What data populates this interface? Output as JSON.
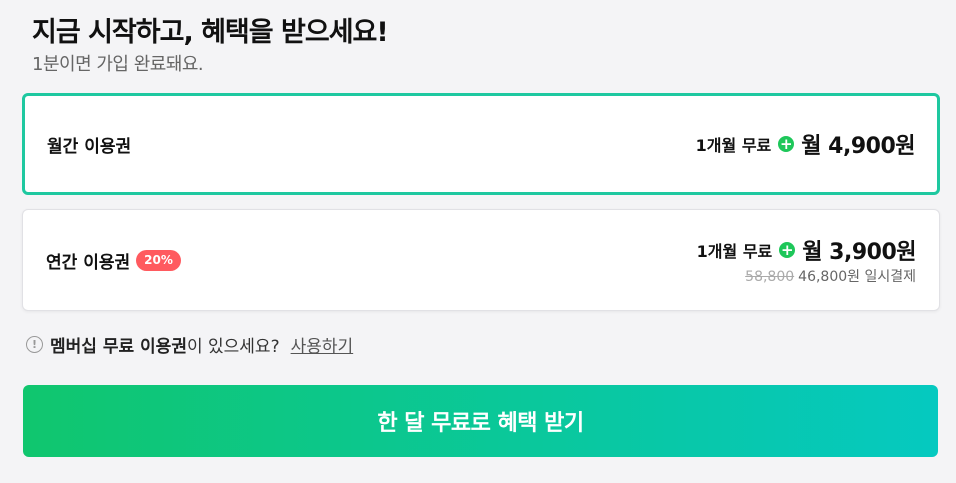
{
  "header": {
    "title": "지금 시작하고, 혜택을 받으세요!",
    "subtitle": "1분이면 가입 완료돼요."
  },
  "plans": [
    {
      "name": "월간 이용권",
      "free_period": "1개월 무료",
      "price": "월 4,900원",
      "selected": true
    },
    {
      "name": "연간 이용권",
      "badge": "20%",
      "free_period": "1개월 무료",
      "price": "월 3,900원",
      "original_price": "58,800",
      "lump_sum": "46,800원 일시결제",
      "selected": false
    }
  ],
  "notice": {
    "bold_text": "멤버십 무료 이용권",
    "text": "이 있으세요?",
    "link": "사용하기"
  },
  "cta": {
    "label": "한 달 무료로 혜택 받기"
  },
  "colors": {
    "accent": "#1ec8a0",
    "plus_icon": "#1ec75a",
    "badge": "#ff5a5f",
    "cta_gradient_start": "#10c66e",
    "cta_gradient_end": "#05c9c0"
  },
  "icons": {
    "plus": "plus-circle-icon",
    "info": "info-circle-icon"
  }
}
